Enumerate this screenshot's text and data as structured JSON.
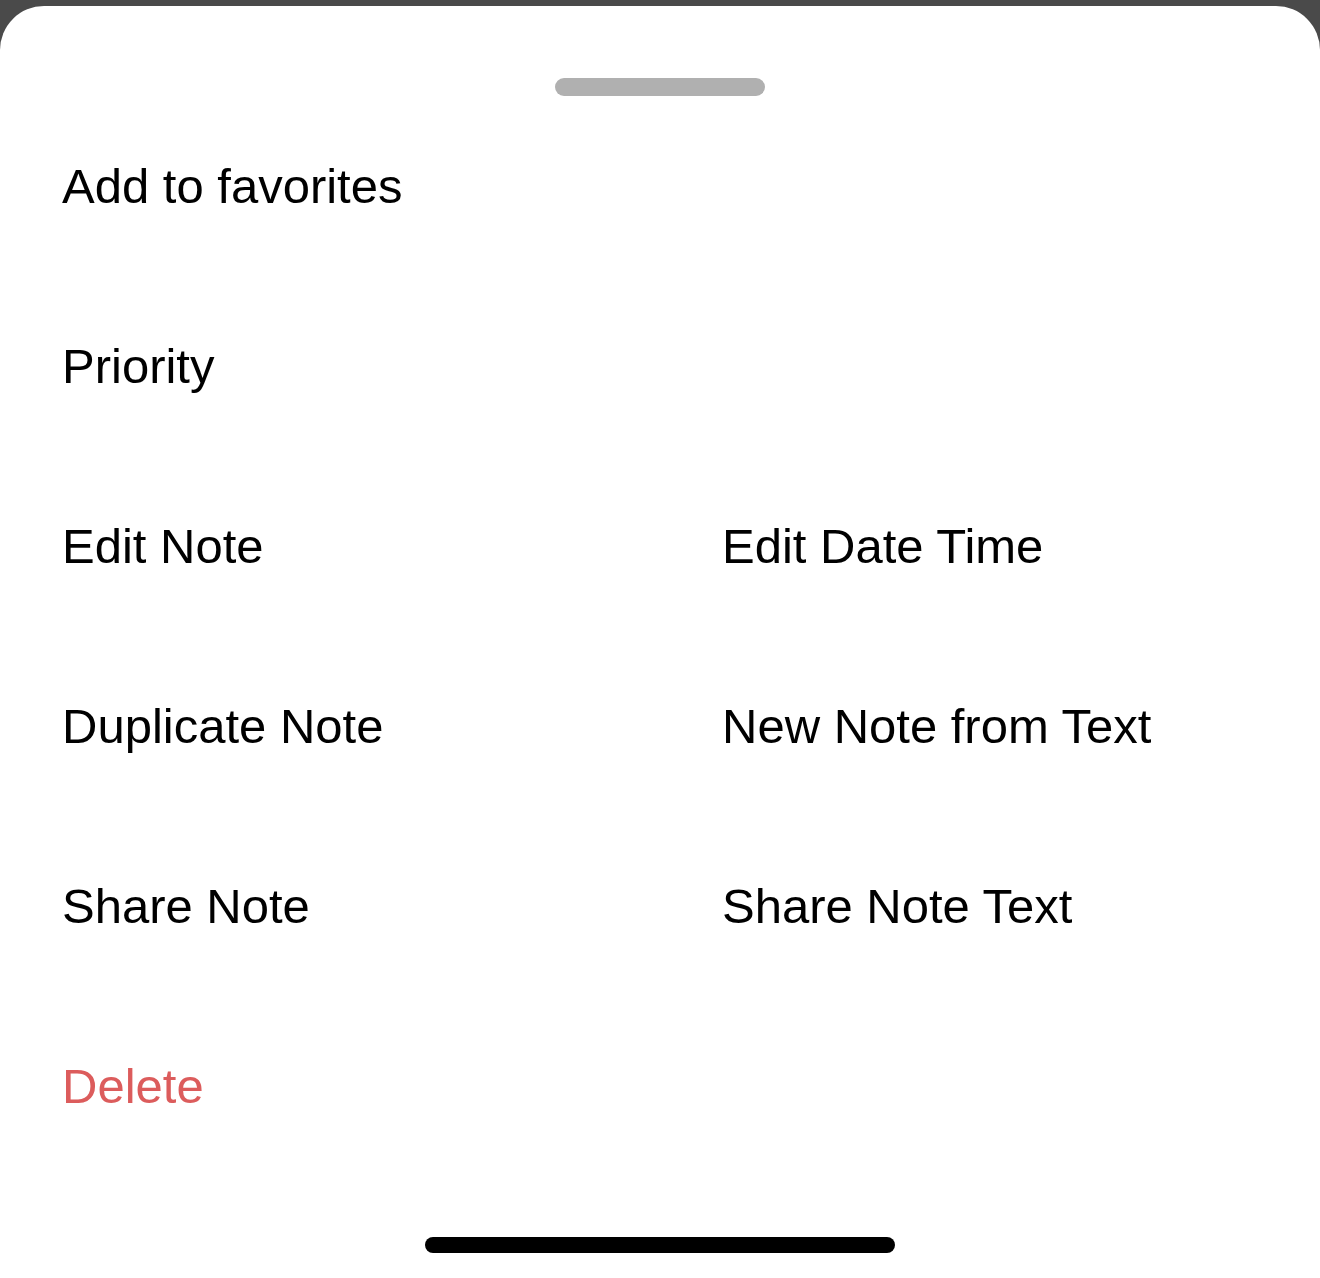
{
  "sheet": {
    "rows": [
      [
        {
          "label": "Add to favorites",
          "kind": "normal"
        }
      ],
      [
        {
          "label": "Priority",
          "kind": "normal"
        }
      ],
      [
        {
          "label": "Edit Note",
          "kind": "normal"
        },
        {
          "label": "Edit Date Time",
          "kind": "normal"
        }
      ],
      [
        {
          "label": "Duplicate Note",
          "kind": "normal"
        },
        {
          "label": "New Note from Text",
          "kind": "normal"
        }
      ],
      [
        {
          "label": "Share Note",
          "kind": "normal"
        },
        {
          "label": "Share Note Text",
          "kind": "normal"
        }
      ],
      [
        {
          "label": "Delete",
          "kind": "destructive"
        }
      ]
    ]
  }
}
